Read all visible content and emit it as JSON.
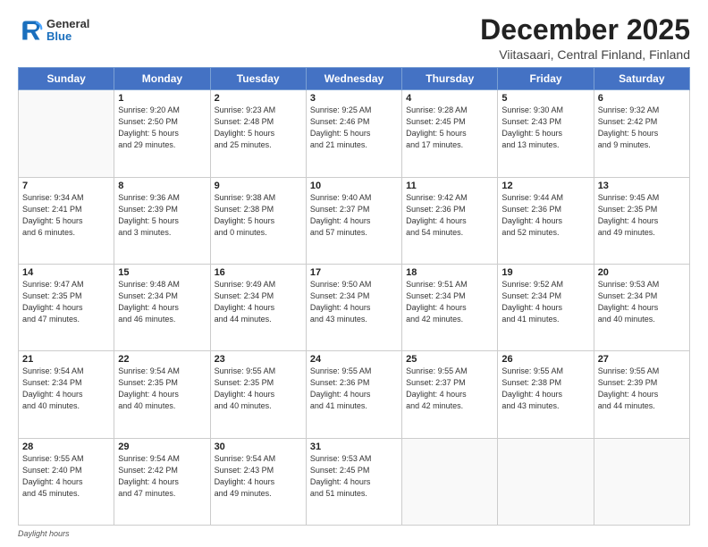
{
  "logo": {
    "general": "General",
    "blue": "Blue"
  },
  "header": {
    "title": "December 2025",
    "location": "Viitasaari, Central Finland, Finland"
  },
  "weekdays": [
    "Sunday",
    "Monday",
    "Tuesday",
    "Wednesday",
    "Thursday",
    "Friday",
    "Saturday"
  ],
  "days": [
    {
      "num": "",
      "info": ""
    },
    {
      "num": "1",
      "info": "Sunrise: 9:20 AM\nSunset: 2:50 PM\nDaylight: 5 hours\nand 29 minutes."
    },
    {
      "num": "2",
      "info": "Sunrise: 9:23 AM\nSunset: 2:48 PM\nDaylight: 5 hours\nand 25 minutes."
    },
    {
      "num": "3",
      "info": "Sunrise: 9:25 AM\nSunset: 2:46 PM\nDaylight: 5 hours\nand 21 minutes."
    },
    {
      "num": "4",
      "info": "Sunrise: 9:28 AM\nSunset: 2:45 PM\nDaylight: 5 hours\nand 17 minutes."
    },
    {
      "num": "5",
      "info": "Sunrise: 9:30 AM\nSunset: 2:43 PM\nDaylight: 5 hours\nand 13 minutes."
    },
    {
      "num": "6",
      "info": "Sunrise: 9:32 AM\nSunset: 2:42 PM\nDaylight: 5 hours\nand 9 minutes."
    },
    {
      "num": "7",
      "info": "Sunrise: 9:34 AM\nSunset: 2:41 PM\nDaylight: 5 hours\nand 6 minutes."
    },
    {
      "num": "8",
      "info": "Sunrise: 9:36 AM\nSunset: 2:39 PM\nDaylight: 5 hours\nand 3 minutes."
    },
    {
      "num": "9",
      "info": "Sunrise: 9:38 AM\nSunset: 2:38 PM\nDaylight: 5 hours\nand 0 minutes."
    },
    {
      "num": "10",
      "info": "Sunrise: 9:40 AM\nSunset: 2:37 PM\nDaylight: 4 hours\nand 57 minutes."
    },
    {
      "num": "11",
      "info": "Sunrise: 9:42 AM\nSunset: 2:36 PM\nDaylight: 4 hours\nand 54 minutes."
    },
    {
      "num": "12",
      "info": "Sunrise: 9:44 AM\nSunset: 2:36 PM\nDaylight: 4 hours\nand 52 minutes."
    },
    {
      "num": "13",
      "info": "Sunrise: 9:45 AM\nSunset: 2:35 PM\nDaylight: 4 hours\nand 49 minutes."
    },
    {
      "num": "14",
      "info": "Sunrise: 9:47 AM\nSunset: 2:35 PM\nDaylight: 4 hours\nand 47 minutes."
    },
    {
      "num": "15",
      "info": "Sunrise: 9:48 AM\nSunset: 2:34 PM\nDaylight: 4 hours\nand 46 minutes."
    },
    {
      "num": "16",
      "info": "Sunrise: 9:49 AM\nSunset: 2:34 PM\nDaylight: 4 hours\nand 44 minutes."
    },
    {
      "num": "17",
      "info": "Sunrise: 9:50 AM\nSunset: 2:34 PM\nDaylight: 4 hours\nand 43 minutes."
    },
    {
      "num": "18",
      "info": "Sunrise: 9:51 AM\nSunset: 2:34 PM\nDaylight: 4 hours\nand 42 minutes."
    },
    {
      "num": "19",
      "info": "Sunrise: 9:52 AM\nSunset: 2:34 PM\nDaylight: 4 hours\nand 41 minutes."
    },
    {
      "num": "20",
      "info": "Sunrise: 9:53 AM\nSunset: 2:34 PM\nDaylight: 4 hours\nand 40 minutes."
    },
    {
      "num": "21",
      "info": "Sunrise: 9:54 AM\nSunset: 2:34 PM\nDaylight: 4 hours\nand 40 minutes."
    },
    {
      "num": "22",
      "info": "Sunrise: 9:54 AM\nSunset: 2:35 PM\nDaylight: 4 hours\nand 40 minutes."
    },
    {
      "num": "23",
      "info": "Sunrise: 9:55 AM\nSunset: 2:35 PM\nDaylight: 4 hours\nand 40 minutes."
    },
    {
      "num": "24",
      "info": "Sunrise: 9:55 AM\nSunset: 2:36 PM\nDaylight: 4 hours\nand 41 minutes."
    },
    {
      "num": "25",
      "info": "Sunrise: 9:55 AM\nSunset: 2:37 PM\nDaylight: 4 hours\nand 42 minutes."
    },
    {
      "num": "26",
      "info": "Sunrise: 9:55 AM\nSunset: 2:38 PM\nDaylight: 4 hours\nand 43 minutes."
    },
    {
      "num": "27",
      "info": "Sunrise: 9:55 AM\nSunset: 2:39 PM\nDaylight: 4 hours\nand 44 minutes."
    },
    {
      "num": "28",
      "info": "Sunrise: 9:55 AM\nSunset: 2:40 PM\nDaylight: 4 hours\nand 45 minutes."
    },
    {
      "num": "29",
      "info": "Sunrise: 9:54 AM\nSunset: 2:42 PM\nDaylight: 4 hours\nand 47 minutes."
    },
    {
      "num": "30",
      "info": "Sunrise: 9:54 AM\nSunset: 2:43 PM\nDaylight: 4 hours\nand 49 minutes."
    },
    {
      "num": "31",
      "info": "Sunrise: 9:53 AM\nSunset: 2:45 PM\nDaylight: 4 hours\nand 51 minutes."
    },
    {
      "num": "",
      "info": ""
    },
    {
      "num": "",
      "info": ""
    },
    {
      "num": "",
      "info": ""
    },
    {
      "num": "",
      "info": ""
    }
  ],
  "footer": {
    "daylight_label": "Daylight hours"
  }
}
